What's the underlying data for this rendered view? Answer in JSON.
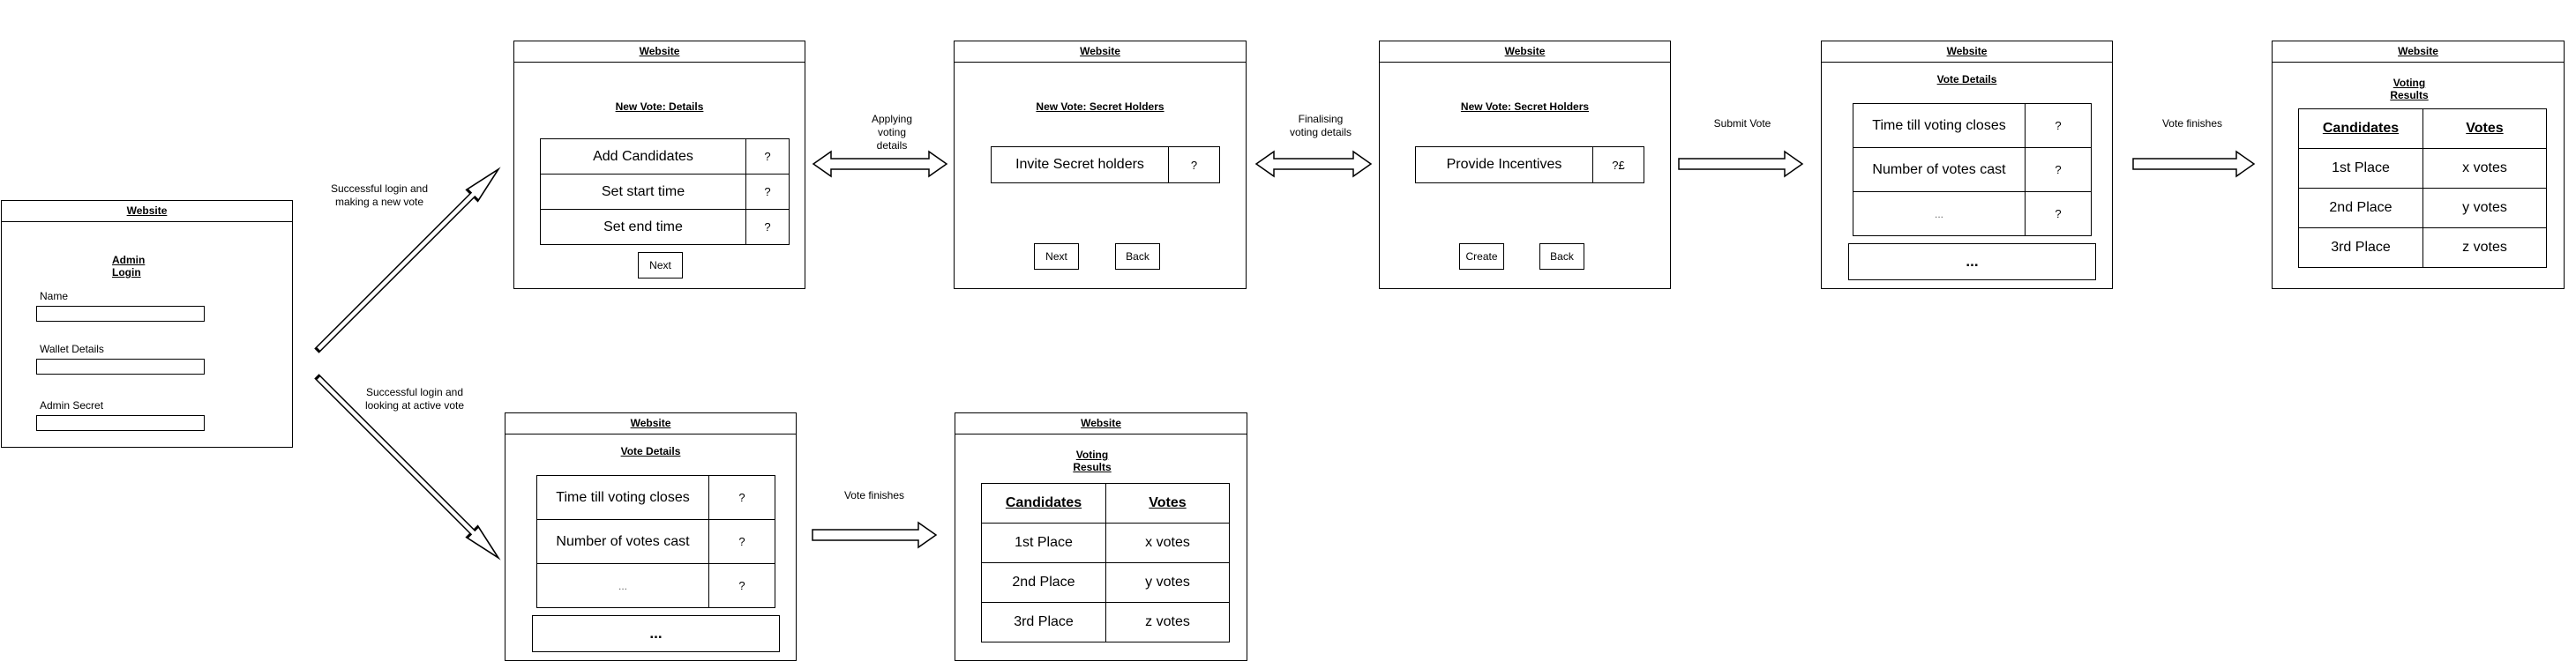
{
  "window_title": "Website",
  "login": {
    "heading": "Admin Login",
    "fields": [
      "Name",
      "Wallet Details",
      "Admin Secret"
    ]
  },
  "arrow_labels": {
    "new_vote": "Successful login and making a new vote",
    "active_vote": "Successful login and looking at active vote",
    "applying": "Applying voting details",
    "finalising": "Finalising voting details",
    "submit": "Submit Vote",
    "vote_finishes": "Vote finishes"
  },
  "details": {
    "heading": "New Vote: Details",
    "rows": [
      {
        "label": "Add Candidates",
        "value": "?"
      },
      {
        "label": "Set start time",
        "value": "?"
      },
      {
        "label": "Set end time",
        "value": "?"
      }
    ],
    "next_button": "Next"
  },
  "secret_holders": {
    "heading": "New Vote: Secret Holders",
    "row": {
      "label": "Invite Secret holders",
      "value": "?"
    },
    "next_button": "Next",
    "back_button": "Back"
  },
  "incentives": {
    "heading": "New Vote: Secret Holders",
    "row": {
      "label": "Provide Incentives",
      "value": "?£"
    },
    "create_button": "Create",
    "back_button": "Back"
  },
  "vote_details": {
    "heading": "Vote Details",
    "rows": [
      {
        "label": "Time till voting closes",
        "value": "?"
      },
      {
        "label": "Number of votes cast",
        "value": "?"
      },
      {
        "label": "...",
        "value": "?"
      }
    ],
    "more": "..."
  },
  "results": {
    "heading": "Voting Results",
    "col_candidates": "Candidates",
    "col_votes": "Votes",
    "rows": [
      {
        "place": "1st Place",
        "votes": "x votes"
      },
      {
        "place": "2nd Place",
        "votes": "y votes"
      },
      {
        "place": "3rd Place",
        "votes": "z votes"
      }
    ]
  }
}
